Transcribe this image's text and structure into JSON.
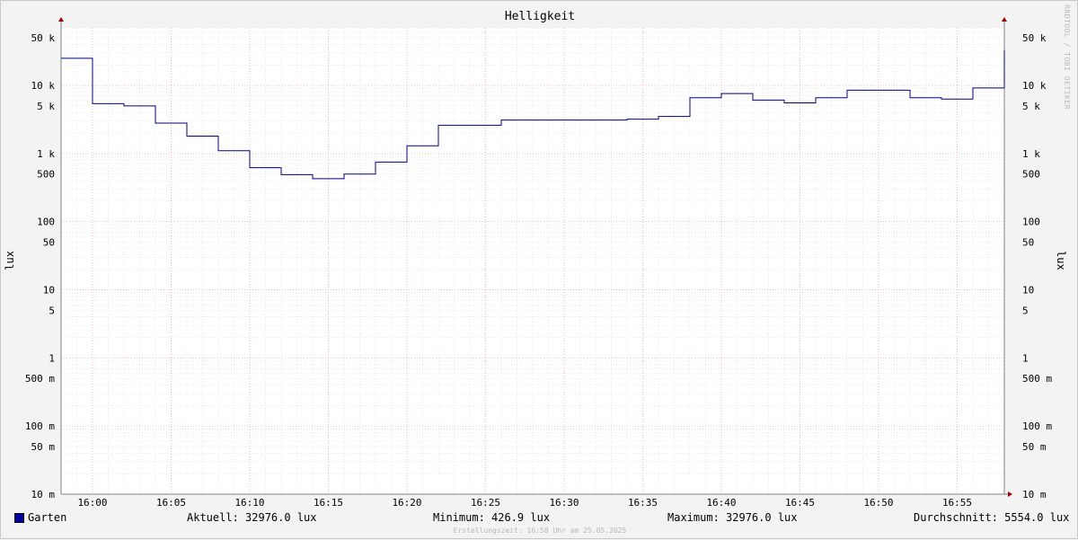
{
  "watermark": "RRDTOOL / TOBI OETIKER",
  "legend": {
    "series_name": "Garten",
    "current": "Aktuell: 32976.0 lux",
    "minimum": "Minimum: 426.9 lux",
    "maximum": "Maximum: 32976.0 lux",
    "average": "Durchschnitt: 5554.0 lux"
  },
  "created": "Erstellungszeit: 16:58 Uhr am 25.05.2025",
  "colors": {
    "line": "#000080",
    "swatch": "#0000a0",
    "grid_major": "#e8a0a0",
    "grid_minor": "#d4d4d4",
    "axis": "#808080",
    "arrow": "#a00000",
    "plot_bg": "#ffffff"
  },
  "chart_data": {
    "type": "line",
    "title": "Helligkeit",
    "ylabel": "lux",
    "y_scale": "log",
    "ylim": [
      0.01,
      70000
    ],
    "xlim": [
      "15:58",
      "16:58"
    ],
    "x_ticks": [
      "16:00",
      "16:05",
      "16:10",
      "16:15",
      "16:20",
      "16:25",
      "16:30",
      "16:35",
      "16:40",
      "16:45",
      "16:50",
      "16:55"
    ],
    "y_ticks": [
      {
        "value": 50000,
        "label": "50 k"
      },
      {
        "value": 10000,
        "label": "10 k"
      },
      {
        "value": 5000,
        "label": "5 k"
      },
      {
        "value": 1000,
        "label": "1 k"
      },
      {
        "value": 500,
        "label": "500"
      },
      {
        "value": 100,
        "label": "100"
      },
      {
        "value": 50,
        "label": "50"
      },
      {
        "value": 10,
        "label": "10"
      },
      {
        "value": 5,
        "label": "5"
      },
      {
        "value": 1,
        "label": "1"
      },
      {
        "value": 0.5,
        "label": "500 m"
      },
      {
        "value": 0.1,
        "label": "100 m"
      },
      {
        "value": 0.05,
        "label": "50 m"
      },
      {
        "value": 0.01,
        "label": "10 m"
      }
    ],
    "grid": true,
    "series": [
      {
        "name": "Garten",
        "step": true,
        "x": [
          "15:58",
          "16:00",
          "16:02",
          "16:04",
          "16:06",
          "16:08",
          "16:10",
          "16:12",
          "16:14",
          "16:16",
          "16:18",
          "16:20",
          "16:22",
          "16:26",
          "16:34",
          "16:36",
          "16:38",
          "16:40",
          "16:42",
          "16:44",
          "16:46",
          "16:48",
          "16:52",
          "16:54",
          "16:56",
          "16:58"
        ],
        "values": [
          25000,
          5400,
          5000,
          2800,
          1800,
          1100,
          620,
          490,
          427,
          500,
          750,
          1300,
          2600,
          3100,
          3200,
          3500,
          6600,
          7600,
          6100,
          5554,
          6600,
          8500,
          6600,
          6300,
          9200,
          32976
        ]
      }
    ]
  }
}
